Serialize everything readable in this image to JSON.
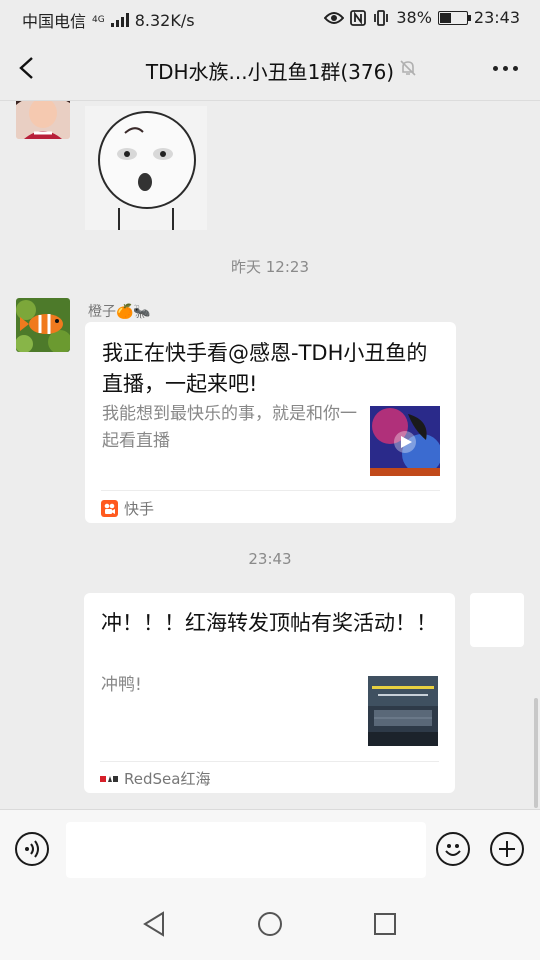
{
  "status_bar": {
    "carrier": "中国电信",
    "network_type": "4G",
    "speed": "8.32K/s",
    "battery": "38%",
    "battery_level": 0.38,
    "time": "23:43"
  },
  "nav": {
    "title": "TDH水族...小丑鱼1群(376)"
  },
  "chat": {
    "timestamps": [
      "昨天 12:23",
      "23:43"
    ],
    "messages": [
      {
        "sender": "橙子🍊🐜",
        "card": {
          "title": "我正在快手看@感恩-TDH小丑鱼的直播，一起来吧!",
          "description": "我能想到最快乐的事，就是和你一起看直播",
          "source": "快手"
        }
      },
      {
        "card": {
          "title": "冲！！！红海转发顶帖有奖活动！！",
          "description": "冲鸭!",
          "source": "RedSea红海"
        }
      }
    ]
  },
  "input": {
    "placeholder": ""
  },
  "colors": {
    "background": "#ededed",
    "card": "#ffffff",
    "kuaishou": "#ff5a1f",
    "redsea": "#d6202a"
  }
}
